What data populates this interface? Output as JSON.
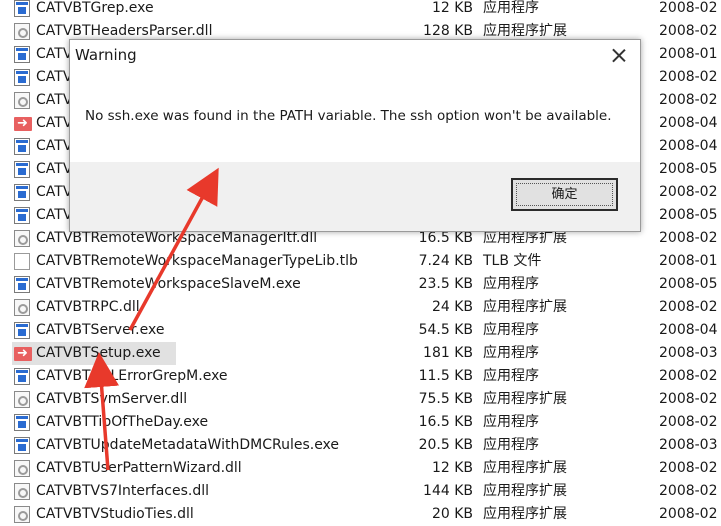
{
  "file_list": {
    "rows": [
      {
        "name": "CATVBTGrep.exe",
        "size": "12 KB",
        "type": "应用程序",
        "date": "2008-02",
        "icon": "exe-icon"
      },
      {
        "name": "CATVBTHeadersParser.dll",
        "size": "128 KB",
        "type": "应用程序扩展",
        "date": "2008-02",
        "icon": "dll-icon"
      },
      {
        "name": "CATV",
        "size": "",
        "type": "",
        "date": "2008-01",
        "icon": "exe-icon"
      },
      {
        "name": "CATV",
        "size": "",
        "type": "",
        "date": "2008-02",
        "icon": "exe-icon"
      },
      {
        "name": "CATV",
        "size": "",
        "type": "",
        "date": "2008-02",
        "icon": "dll-icon"
      },
      {
        "name": "CATV",
        "size": "",
        "type": "",
        "date": "2008-04",
        "icon": "setup-icon"
      },
      {
        "name": "CATV",
        "size": "",
        "type": "",
        "date": "2008-04",
        "icon": "exe-icon"
      },
      {
        "name": "CATV",
        "size": "",
        "type": "",
        "date": "2008-05",
        "icon": "exe-icon"
      },
      {
        "name": "CATV",
        "size": "",
        "type": "",
        "date": "2008-02",
        "icon": "exe-icon"
      },
      {
        "name": "CATV",
        "size": "",
        "type": "",
        "date": "2008-05",
        "icon": "exe-icon"
      },
      {
        "name": "CATVBTRemoteWorkspaceManagerItf.dll",
        "size": "16.5 KB",
        "type": "应用程序扩展",
        "date": "2008-02",
        "icon": "dll-icon"
      },
      {
        "name": "CATVBTRemoteWorkspaceManagerTypeLib.tlb",
        "size": "7.24 KB",
        "type": "TLB 文件",
        "date": "2008-01",
        "icon": "tlb-icon"
      },
      {
        "name": "CATVBTRemoteWorkspaceSlaveM.exe",
        "size": "23.5 KB",
        "type": "应用程序",
        "date": "2008-05",
        "icon": "exe-icon"
      },
      {
        "name": "CATVBTRPC.dll",
        "size": "24 KB",
        "type": "应用程序扩展",
        "date": "2008-02",
        "icon": "dll-icon"
      },
      {
        "name": "CATVBTServer.exe",
        "size": "54.5 KB",
        "type": "应用程序",
        "date": "2008-04",
        "icon": "exe-icon"
      },
      {
        "name": "CATVBTSetup.exe",
        "size": "181 KB",
        "type": "应用程序",
        "date": "2008-03",
        "icon": "setup-icon",
        "selected": true
      },
      {
        "name": "CATVBTSQLErrorGrepM.exe",
        "size": "11.5 KB",
        "type": "应用程序",
        "date": "2008-02",
        "icon": "exe-icon"
      },
      {
        "name": "CATVBTSvmServer.dll",
        "size": "75.5 KB",
        "type": "应用程序扩展",
        "date": "2008-02",
        "icon": "dll-icon"
      },
      {
        "name": "CATVBTTipOfTheDay.exe",
        "size": "16.5 KB",
        "type": "应用程序",
        "date": "2008-02",
        "icon": "exe-icon"
      },
      {
        "name": "CATVBTUpdateMetadataWithDMCRules.exe",
        "size": "20.5 KB",
        "type": "应用程序",
        "date": "2008-03",
        "icon": "exe-icon"
      },
      {
        "name": "CATVBTUserPatternWizard.dll",
        "size": "12 KB",
        "type": "应用程序扩展",
        "date": "2008-02",
        "icon": "dll-icon"
      },
      {
        "name": "CATVBTVS7Interfaces.dll",
        "size": "144 KB",
        "type": "应用程序扩展",
        "date": "2008-02",
        "icon": "dll-icon"
      },
      {
        "name": "CATVBTVStudioTies.dll",
        "size": "20 KB",
        "type": "应用程序扩展",
        "date": "2008-02",
        "icon": "dll-icon"
      }
    ]
  },
  "dialog": {
    "title": "Warning",
    "message": "No ssh.exe was found in the PATH variable. The ssh option won't be available.",
    "ok_label": "确定",
    "close_icon": "close-icon"
  },
  "annotation": {
    "arrow_color": "#e8392b"
  }
}
